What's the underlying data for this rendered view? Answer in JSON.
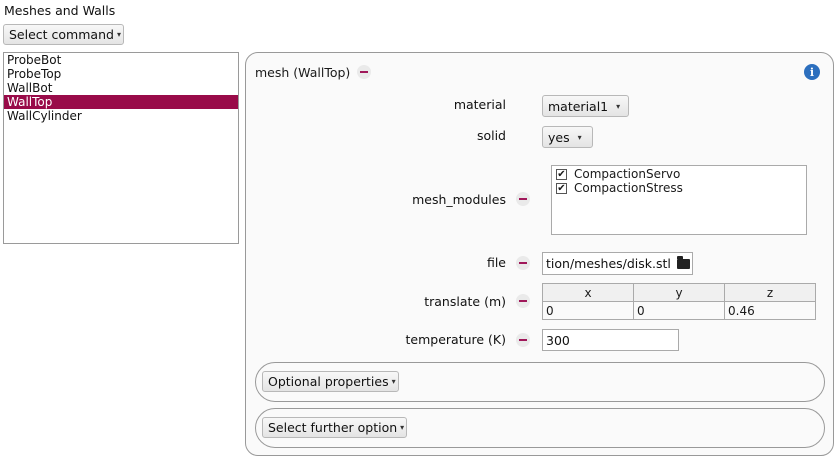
{
  "section_title": "Meshes and Walls",
  "select_command": "Select command",
  "list": {
    "items": [
      {
        "label": "ProbeBot",
        "selected": false
      },
      {
        "label": "ProbeTop",
        "selected": false
      },
      {
        "label": "WallBot",
        "selected": false
      },
      {
        "label": "WallTop",
        "selected": true
      },
      {
        "label": "WallCylinder",
        "selected": false
      }
    ]
  },
  "panel": {
    "title": "mesh (WallTop)",
    "material": {
      "label": "material",
      "value": "material1"
    },
    "solid": {
      "label": "solid",
      "value": "yes"
    },
    "mesh_modules": {
      "label": "mesh_modules",
      "options": [
        {
          "label": "CompactionServo",
          "checked": true
        },
        {
          "label": "CompactionStress",
          "checked": true
        }
      ]
    },
    "file": {
      "label": "file",
      "value": "tion/meshes/disk.stl"
    },
    "translate": {
      "label": "translate (m)",
      "headers": [
        "x",
        "y",
        "z"
      ],
      "values": [
        "0",
        "0",
        "0.46"
      ]
    },
    "temperature": {
      "label": "temperature (K)",
      "value": "300"
    },
    "optional_properties": "Optional properties",
    "select_further_option": "Select further option"
  },
  "icons": {
    "info": "info-icon",
    "folder": "folder-icon",
    "remove": "minus-icon",
    "dropdown": "chevron-down-icon"
  },
  "colors": {
    "selection": "#990b49",
    "remove_accent": "#a0185a",
    "info": "#2c6fbe"
  }
}
